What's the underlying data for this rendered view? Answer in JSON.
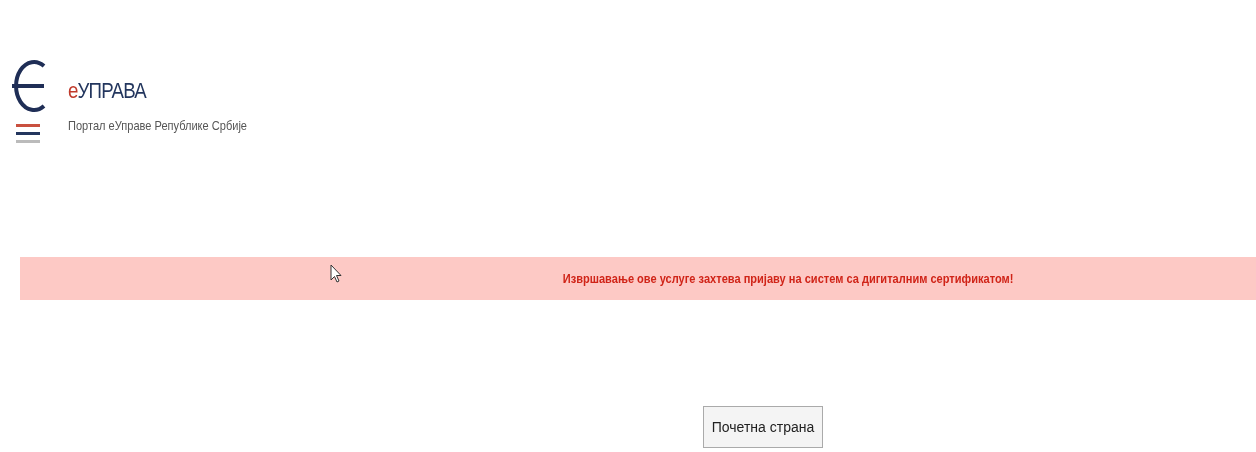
{
  "header": {
    "title_prefix": "е",
    "title": "УПРАВА",
    "subtitle": "Портал еУправе Републике Србије"
  },
  "alert": {
    "message": "Извршавање ове услуге захтева пријаву на систем са дигиталним сертификатом!"
  },
  "buttons": [
    {
      "label": "Почетна страна"
    }
  ]
}
